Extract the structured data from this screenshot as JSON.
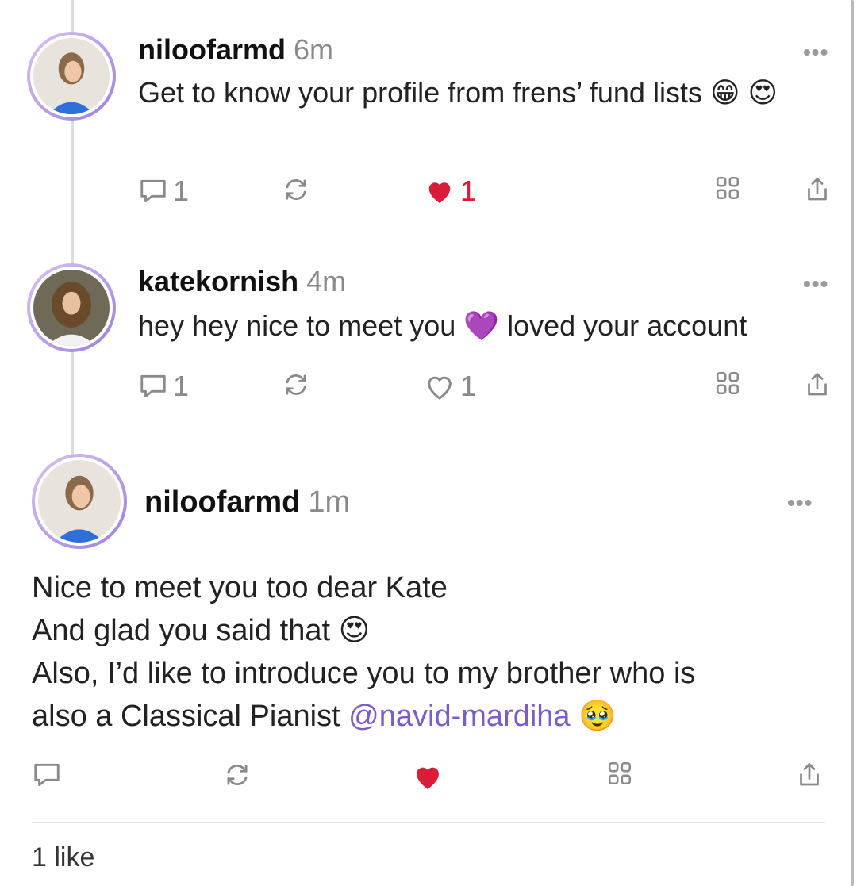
{
  "posts": [
    {
      "username": "niloofarmd",
      "time": "6m",
      "text": "Get to know your profile from frens’ fund lists 😁 😍",
      "reply_count": "1",
      "like_count": "1",
      "liked": true
    },
    {
      "username": "katekornish",
      "time": "4m",
      "text": "hey hey nice to meet you 💜 loved your account",
      "reply_count": "1",
      "like_count": "1",
      "liked": false
    },
    {
      "username": "niloofarmd",
      "time": "1m",
      "lines": [
        "Nice to meet you too dear Kate",
        "And glad you said that 😍",
        "Also, I’d like to introduce you to my brother who is",
        "also a Classical Pianist"
      ],
      "mention": "@navid-mardiha",
      "trailing_emoji": "🥹",
      "liked": true
    }
  ],
  "footer": {
    "likes_summary": "1 like"
  },
  "icons": {
    "reply": "comment-icon",
    "repost": "repost-icon",
    "like": "heart-icon",
    "tip": "grid-icon",
    "share": "share-icon",
    "more": "more-icon"
  },
  "colors": {
    "like": "#d81c3a",
    "mention": "#7b5cc8",
    "avatar_ring": "#9a7fe0"
  }
}
